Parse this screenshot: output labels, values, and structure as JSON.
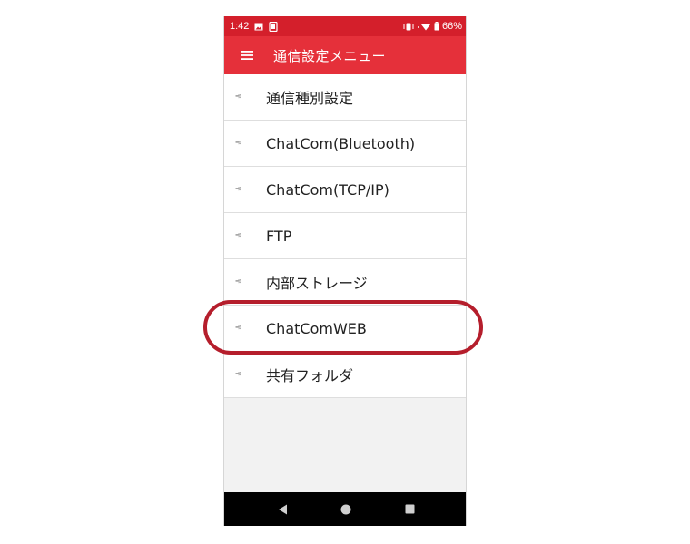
{
  "status_bar": {
    "time": "1:42",
    "battery": "66%",
    "icons": [
      "image-icon",
      "screenshot-icon",
      "vibrate-icon",
      "wifi-icon",
      "battery-icon"
    ]
  },
  "app_bar": {
    "menu_icon": "hamburger-menu-icon",
    "title": "通信設定メニュー"
  },
  "menu": {
    "items": [
      {
        "arrow": "➾",
        "label": "通信種別設定"
      },
      {
        "arrow": "➾",
        "label": "ChatCom(Bluetooth)"
      },
      {
        "arrow": "➾",
        "label": "ChatCom(TCP/IP)"
      },
      {
        "arrow": "➾",
        "label": "FTP"
      },
      {
        "arrow": "➾",
        "label": "内部ストレージ"
      },
      {
        "arrow": "➾",
        "label": "ChatComWEB"
      },
      {
        "arrow": "➾",
        "label": "共有フォルダ"
      }
    ],
    "highlighted_index": 5
  },
  "nav_bar": {
    "buttons": [
      "back-icon",
      "home-icon",
      "recents-icon"
    ]
  },
  "colors": {
    "status_bar": "#d41f2b",
    "app_bar": "#e5303a",
    "highlight_ring": "#b51e2c",
    "nav_bar": "#000000"
  }
}
